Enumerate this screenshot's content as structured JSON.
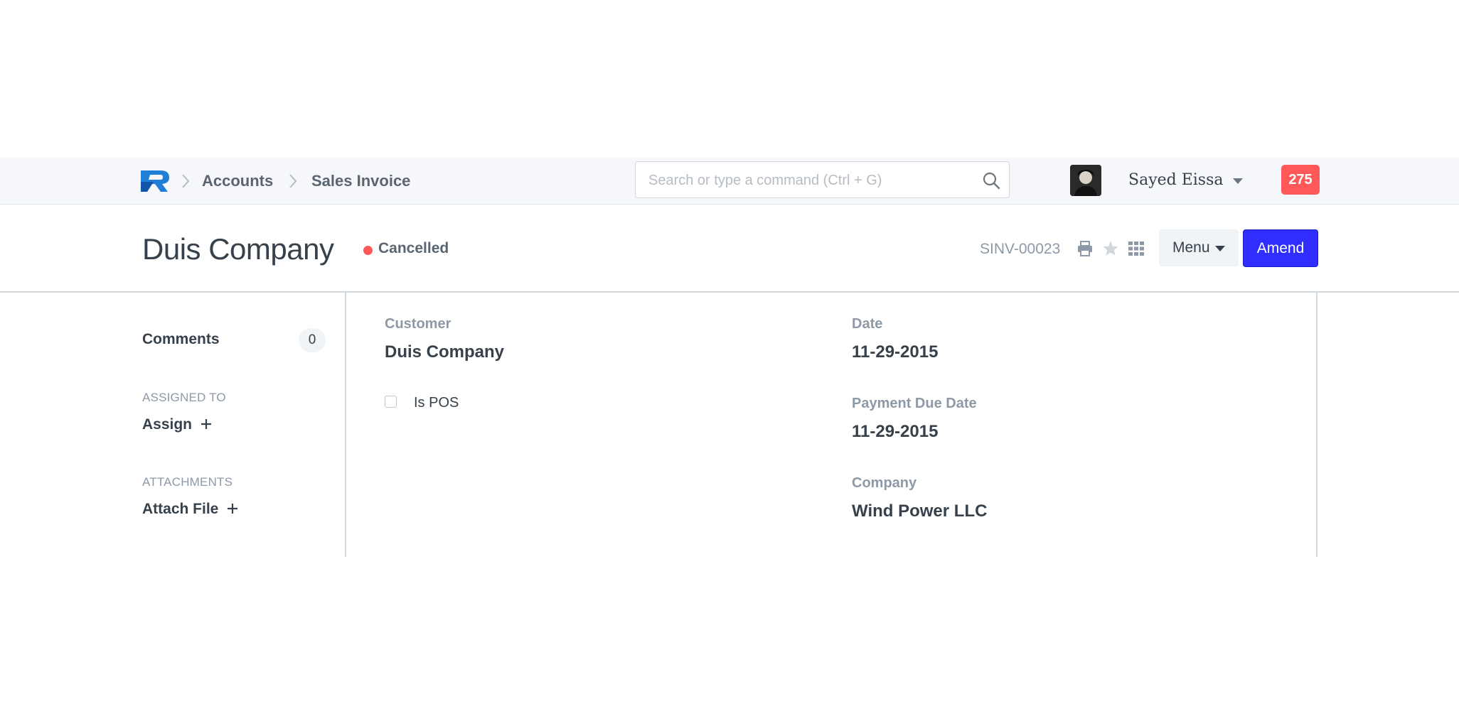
{
  "navbar": {
    "breadcrumbs": [
      "Accounts",
      "Sales Invoice"
    ],
    "search_placeholder": "Search or type a command (Ctrl + G)",
    "user_name": "Sayed Eissa",
    "notification_count": "275"
  },
  "page_head": {
    "title": "Duis Company",
    "status": "Cancelled",
    "status_color": "#ff5858",
    "doc_id": "SINV-00023",
    "menu_label": "Menu",
    "primary_action_label": "Amend",
    "primary_color": "#2f2eff"
  },
  "sidebar": {
    "comments_label": "Comments",
    "comments_count": "0",
    "assigned_to_label": "ASSIGNED TO",
    "assign_label": "Assign",
    "attachments_label": "ATTACHMENTS",
    "attach_label": "Attach File"
  },
  "form": {
    "customer_label": "Customer",
    "customer_value": "Duis Company",
    "is_pos_label": "Is POS",
    "is_pos_checked": false,
    "date_label": "Date",
    "date_value": "11-29-2015",
    "due_date_label": "Payment Due Date",
    "due_date_value": "11-29-2015",
    "company_label": "Company",
    "company_value": "Wind Power LLC"
  }
}
